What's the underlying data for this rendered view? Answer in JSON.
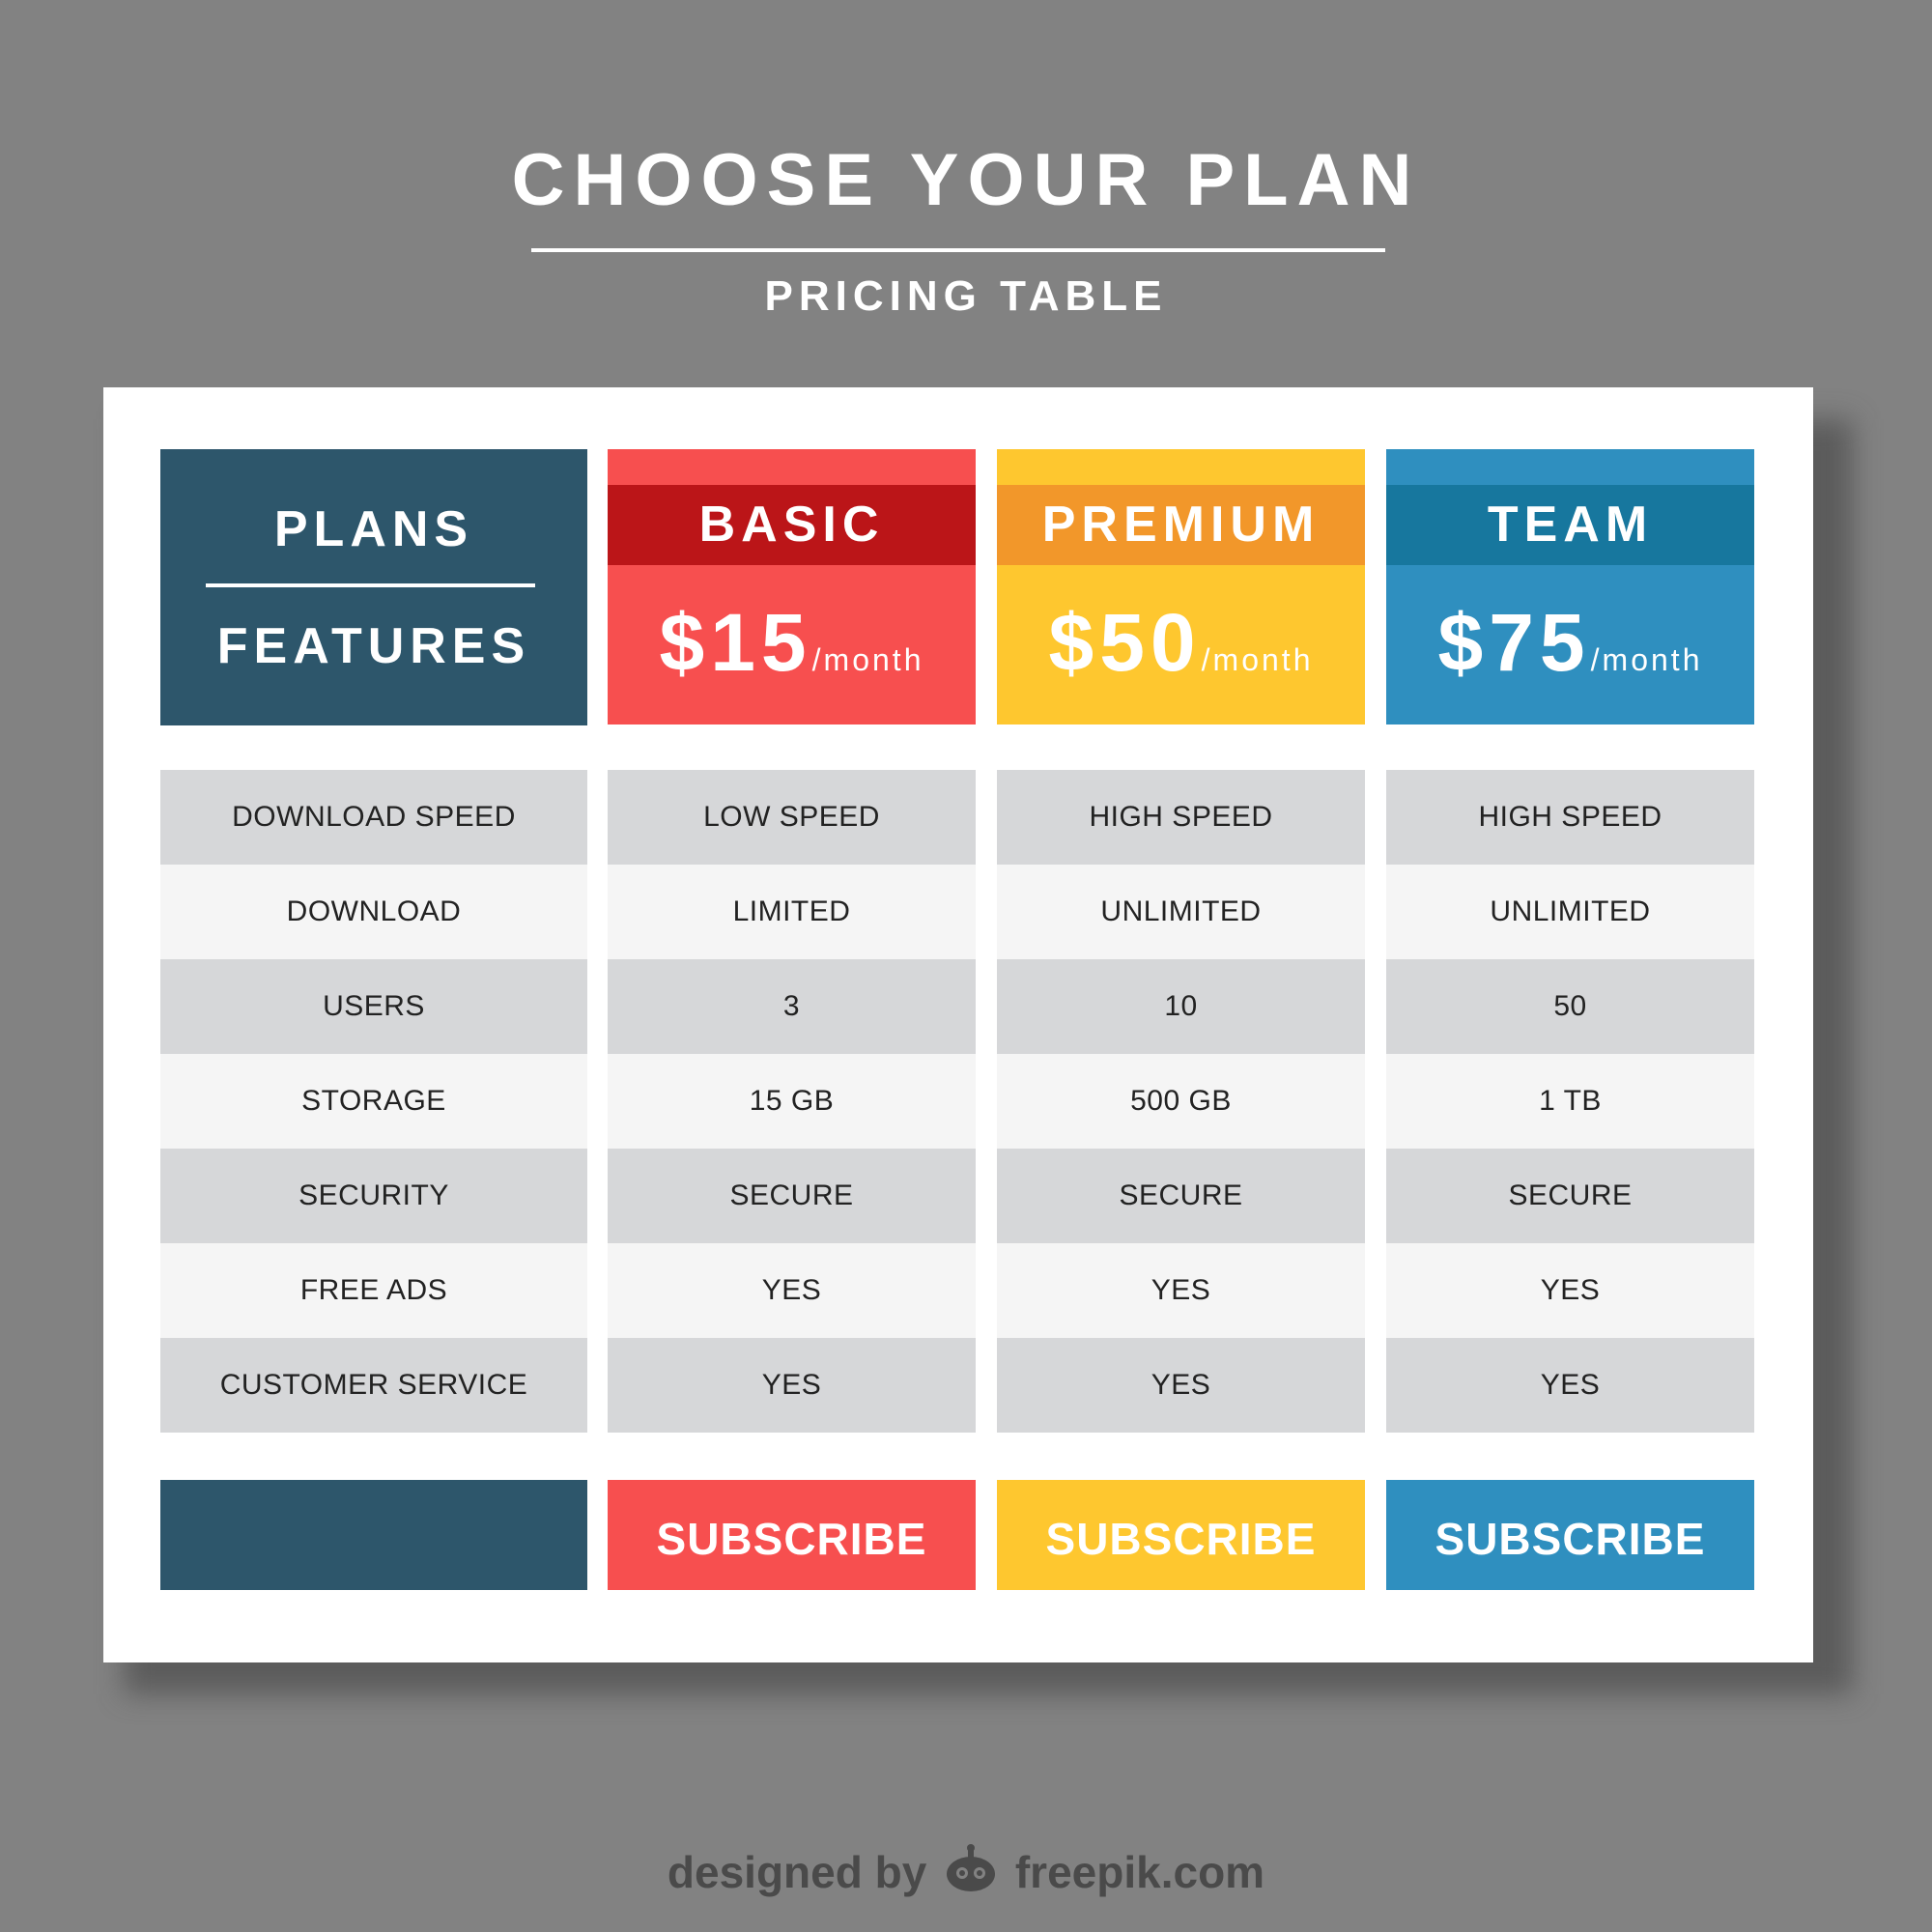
{
  "header": {
    "title": "CHOOSE YOUR PLAN",
    "subtitle": "PRICING TABLE"
  },
  "colors": {
    "background": "#828282",
    "card": "#ffffff",
    "features": "#2d566b",
    "basic_light": "#f74f4f",
    "basic_dark": "#bb1518",
    "premium_light": "#fec72f",
    "premium_dark": "#f2972a",
    "team_light": "#2f8fbf",
    "team_dark": "#17779e",
    "row_dark": "#d6d7d9",
    "row_light": "#f5f5f5"
  },
  "features_column": {
    "header_top": "PLANS",
    "header_bottom": "FEATURES",
    "rows": [
      "DOWNLOAD SPEED",
      "DOWNLOAD",
      "USERS",
      "STORAGE",
      "SECURITY",
      "FREE ADS",
      "CUSTOMER SERVICE"
    ]
  },
  "plans": [
    {
      "name": "BASIC",
      "price": "$15",
      "period": "/month",
      "values": [
        "LOW SPEED",
        "LIMITED",
        "3",
        "15 GB",
        "SECURE",
        "YES",
        "YES"
      ],
      "button": "SUBSCRIBE"
    },
    {
      "name": "PREMIUM",
      "price": "$50",
      "period": "/month",
      "values": [
        "HIGH SPEED",
        "UNLIMITED",
        "10",
        "500 GB",
        "SECURE",
        "YES",
        "YES"
      ],
      "button": "SUBSCRIBE"
    },
    {
      "name": "TEAM",
      "price": "$75",
      "period": "/month",
      "values": [
        "HIGH SPEED",
        "UNLIMITED",
        "50",
        "1 TB",
        "SECURE",
        "YES",
        "YES"
      ],
      "button": "SUBSCRIBE"
    }
  ],
  "credit": {
    "prefix": "designed by",
    "brand": "freepik.com",
    "icon": "freepik-logo-icon"
  }
}
